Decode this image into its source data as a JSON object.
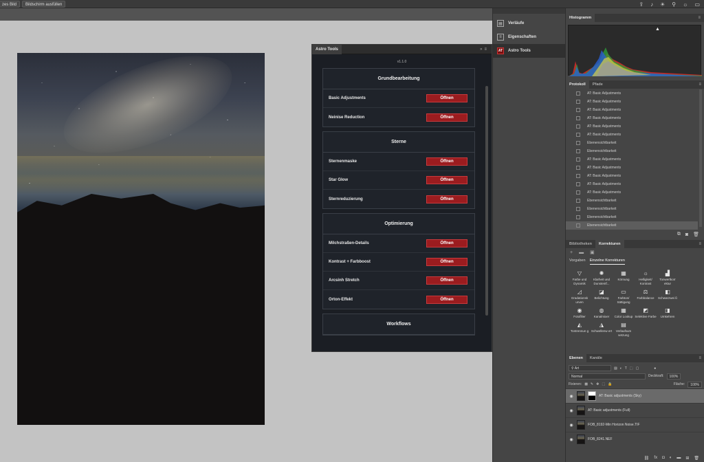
{
  "topbar": {
    "btn_full_image": "zes Bild",
    "btn_fill_screen": "Bildschirm ausfüllen",
    "icons": [
      "share-icon",
      "bell-icon",
      "lightbulb-icon",
      "search-icon",
      "brightness-icon",
      "workspace-icon"
    ]
  },
  "astro_tools": {
    "tab_label": "Astro Tools",
    "collapse_glyph": "»",
    "menu_glyph": "≡",
    "version": "v1.1.0",
    "sections": [
      {
        "title": "Grundbearbeitung",
        "rows": [
          {
            "label": "Basic Adjustments",
            "button": "Öffnen"
          },
          {
            "label": "Neinise Reduction",
            "button": "Öffnen"
          }
        ]
      },
      {
        "title": "Sterne",
        "rows": [
          {
            "label": "Sternenmaske",
            "button": "Öffnen"
          },
          {
            "label": "Star Glow",
            "button": "Öffnen"
          },
          {
            "label": "Sternreduzierung",
            "button": "Öffnen"
          }
        ]
      },
      {
        "title": "Optimierung",
        "rows": [
          {
            "label": "Milchstraßen-Details",
            "button": "Öffnen"
          },
          {
            "label": "Kontrast + Farbboost",
            "button": "Öffnen"
          },
          {
            "label": "Arcsinh Stretch",
            "button": "Öffnen"
          },
          {
            "label": "Orton-Effekt",
            "button": "Öffnen"
          }
        ]
      },
      {
        "title": "Workflows",
        "rows": []
      }
    ]
  },
  "icon_panel": {
    "items": [
      {
        "label": "Verläufe",
        "icon": "gradient-icon"
      },
      {
        "label": "Eigenschaften",
        "icon": "properties-icon"
      },
      {
        "label": "Astro Tools",
        "icon": "astro-tools-icon",
        "badge": "AT"
      }
    ]
  },
  "histogram": {
    "tab": "Histogramm",
    "warning_glyph": "▲",
    "menu_glyph": "≡"
  },
  "protokoll": {
    "tabs": [
      "Protokoll",
      "Pfade"
    ],
    "menu_glyph": "≡",
    "items": [
      "AT: Basic Adjustments",
      "AT: Basic Adjustments",
      "AT: Basic Adjustments",
      "AT: Basic Adjustments",
      "AT: Basic Adjustments",
      "AT: Basic Adjustments",
      "Ebenensichtbarkeit",
      "Ebenensichtbarkeit",
      "AT: Basic Adjustments",
      "AT: Basic Adjustments",
      "AT: Basic Adjustments",
      "AT: Basic Adjustments",
      "AT: Basic Adjustments",
      "Ebenensichtbarkeit",
      "Ebenensichtbarkeit",
      "Ebenensichtbarkeit",
      "Ebenensichtbarkeit"
    ],
    "selected_index": 16
  },
  "korrekturen": {
    "tabs": [
      "Bibliotheken",
      "Korrekturen"
    ],
    "subtabs": [
      "Vorgaben",
      "Einzelne Korrekturen"
    ],
    "items": [
      {
        "label": "Farbe und Dynamik",
        "glyph": "▽"
      },
      {
        "label": "Klarheit und Dunstentf...",
        "glyph": "✺"
      },
      {
        "label": "Körnung",
        "glyph": "▦"
      },
      {
        "label": "Helligkeit/ Kontrast",
        "glyph": "☼"
      },
      {
        "label": "Tonwertkorr ektur",
        "glyph": "▟"
      },
      {
        "label": "Gradationsk urven",
        "glyph": "◿"
      },
      {
        "label": "Belichtung",
        "glyph": "◪"
      },
      {
        "label": "Farbton/ Sättigung",
        "glyph": "▭"
      },
      {
        "label": "Farbbalance",
        "glyph": "⚖"
      },
      {
        "label": "Schwarzwei ß",
        "glyph": "◧"
      },
      {
        "label": "Fotofilter",
        "glyph": "◉"
      },
      {
        "label": "Kanalmixer",
        "glyph": "◍"
      },
      {
        "label": "Color Lookup",
        "glyph": "▦"
      },
      {
        "label": "Selektive Farbe",
        "glyph": "◩"
      },
      {
        "label": "Umkehren",
        "glyph": "◨"
      },
      {
        "label": "Tontrennun g",
        "glyph": "◭"
      },
      {
        "label": "Schwellenw ert",
        "glyph": "◮"
      },
      {
        "label": "Verlaufsum setzung",
        "glyph": "▤"
      }
    ]
  },
  "layers": {
    "tabs": [
      "Ebenen",
      "Kanäle"
    ],
    "filter_kind": "Art",
    "blend_mode": "Normal",
    "opacity_label": "Deckkraft:",
    "opacity_value": "100%",
    "lock_label": "Fixieren:",
    "fill_label": "Fläche:",
    "fill_value": "100%",
    "items": [
      {
        "name": "AT: Basic adjustments (Sky)",
        "has_mask": true,
        "selected": true
      },
      {
        "name": "AT: Basic adjustments (Full)",
        "has_mask": false,
        "selected": false
      },
      {
        "name": "FOB_8192-Min Horizon Noise.TIF",
        "has_mask": false,
        "selected": false
      },
      {
        "name": "FOB_8241.NEF",
        "has_mask": false,
        "selected": false
      }
    ]
  },
  "colors": {
    "accent_red": "#9b1c1f",
    "panel_bg": "#454545",
    "astro_bg": "#1b1e24"
  }
}
